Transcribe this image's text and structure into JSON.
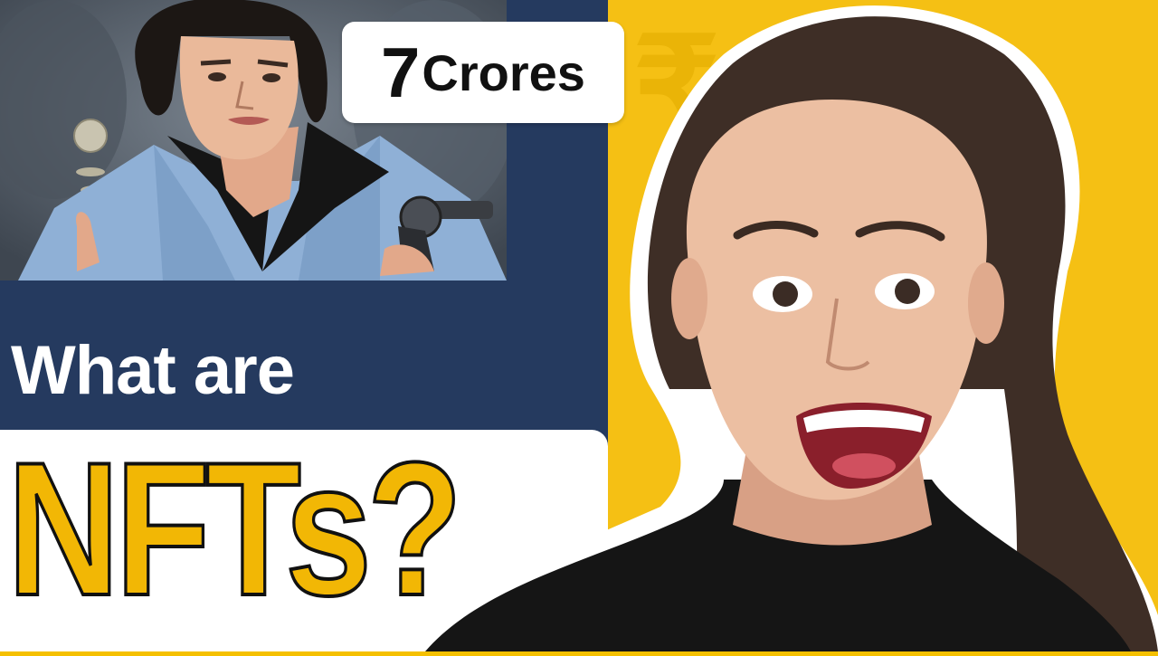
{
  "thumbnail": {
    "badge": {
      "number": "7",
      "word": "Crores"
    },
    "headline_line1": "What are",
    "headline_line2": "NFTs?",
    "colors": {
      "navy": "#253a5f",
      "yellow": "#f5c014",
      "accent_text": "#f2b705",
      "white": "#ffffff"
    },
    "icons": {
      "currency": "rupee-icon"
    }
  }
}
